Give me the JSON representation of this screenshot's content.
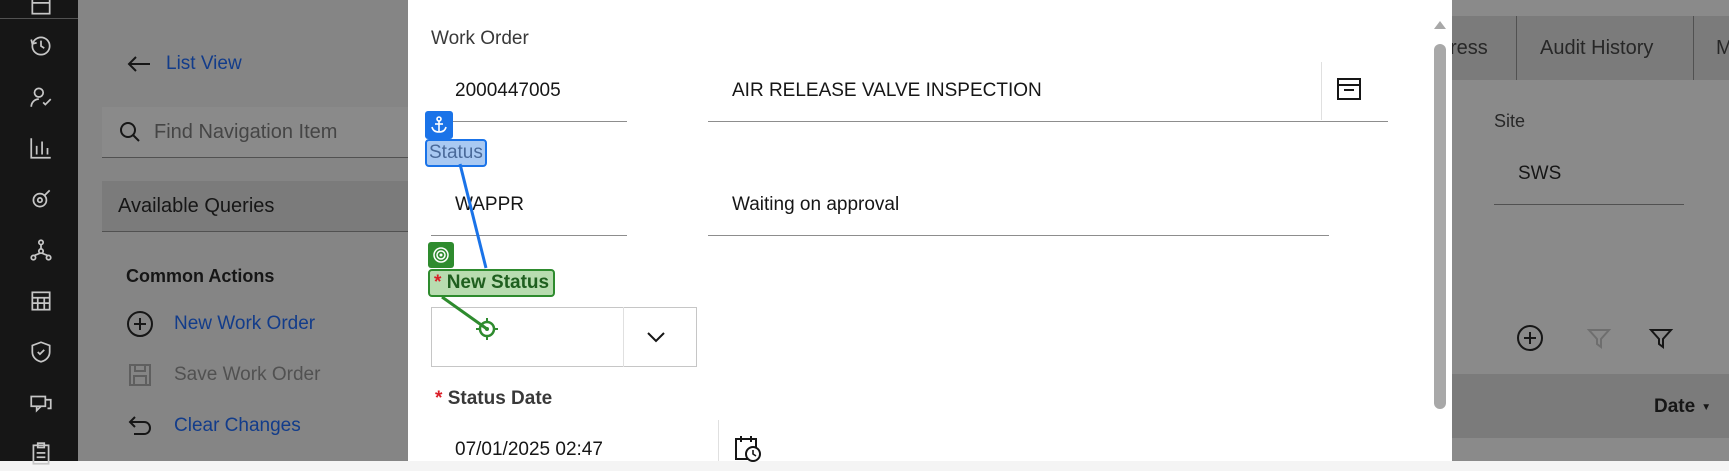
{
  "nav": {
    "list_view": "List View",
    "search_placeholder": "Find Navigation Item",
    "available_queries": "Available Queries",
    "common_actions": "Common Actions",
    "actions": [
      {
        "label": "New Work Order",
        "enabled": true
      },
      {
        "label": "Save Work Order",
        "enabled": false
      },
      {
        "label": "Clear Changes",
        "enabled": true
      }
    ]
  },
  "tabs": {
    "partial_left": "ress",
    "audit_history": "Audit History",
    "partial_right": "M"
  },
  "site": {
    "label": "Site",
    "value": "SWS"
  },
  "table": {
    "date_header": "Date"
  },
  "dialog": {
    "work_order_label": "Work Order",
    "work_order_number": "2000447005",
    "work_order_description": "AIR RELEASE VALVE INSPECTION",
    "status_label": "Status",
    "status_code": "WAPPR",
    "status_description": "Waiting on approval",
    "new_status_label": "New Status",
    "new_status_value": "",
    "status_date_label": "Status Date",
    "status_date_value": "07/01/2025 02:47",
    "required_marker": "*"
  },
  "colors": {
    "accent_blue": "#0f62fe",
    "required_red": "#da1e28",
    "anchor_blue": "#1a73e8",
    "target_green": "#2e8b2e"
  },
  "icons": [
    "calendar-icon",
    "history-icon",
    "person-check-icon",
    "bar-chart-icon",
    "satellite-icon",
    "network-icon",
    "grid-calendar-icon",
    "shield-check-icon",
    "chat-icon",
    "clipboard-icon",
    "arrow-left-icon",
    "search-icon",
    "add-circle-icon",
    "save-icon",
    "undo-icon",
    "archive-icon",
    "chevron-down-icon",
    "calendar-clock-icon",
    "anchor-icon",
    "target-icon",
    "filter-icon",
    "chevron-up-icon"
  ]
}
